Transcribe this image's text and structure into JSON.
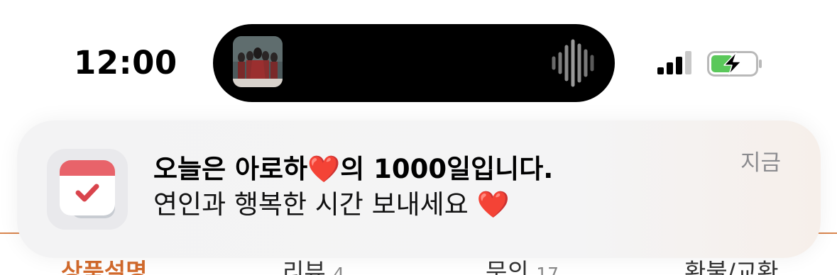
{
  "status_bar": {
    "time": "12:00",
    "signal_icon": "cellular-signal-icon",
    "battery_icon": "battery-charging-icon",
    "battery_level": 0.5,
    "colors": {
      "battery_fill": "#5ac85a"
    }
  },
  "dynamic_island": {
    "artwork_icon": "now-playing-artwork",
    "waveform_icon": "audio-waveform-icon"
  },
  "notification": {
    "app_icon": "calendar-check-icon",
    "title_prefix": "오늘은 아로하",
    "title_heart": "❤️",
    "title_suffix": "의 1000일입니다.",
    "body_text": "연인과 행복한 시간 보내세요",
    "body_heart": "❤️",
    "time": "지금",
    "colors": {
      "icon_header": "#e8636a",
      "icon_check": "#d9444c"
    }
  },
  "page": {
    "tabs": [
      {
        "label": "상품설명",
        "count": ""
      },
      {
        "label": "리뷰",
        "count": "4"
      },
      {
        "label": "문의",
        "count": "17"
      },
      {
        "label": "환불/교환",
        "count": ""
      }
    ],
    "colors": {
      "accent": "#d9854e"
    }
  }
}
